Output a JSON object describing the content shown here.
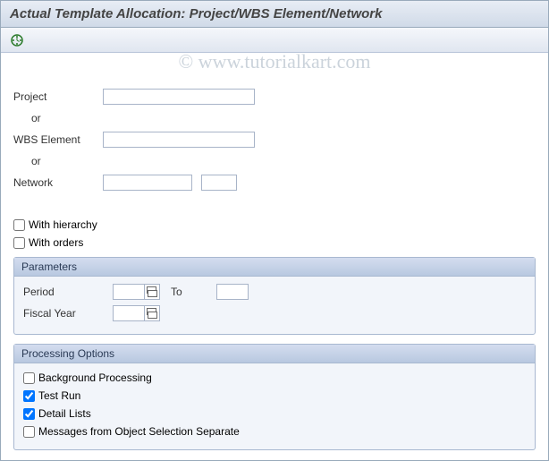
{
  "title": "Actual Template Allocation: Project/WBS Element/Network",
  "watermark": "© www.tutorialkart.com",
  "selection": {
    "project_label": "Project",
    "project_value": "",
    "or1": "or",
    "wbs_label": "WBS Element",
    "wbs_value": "",
    "or2": "or",
    "network_label": "Network",
    "network_value": "",
    "network_activity_value": ""
  },
  "options": {
    "with_hierarchy_label": "With hierarchy",
    "with_hierarchy_checked": false,
    "with_orders_label": "With orders",
    "with_orders_checked": false
  },
  "parameters": {
    "header": "Parameters",
    "period_label": "Period",
    "period_from": "",
    "to_label": "To",
    "period_to": "",
    "fiscal_year_label": "Fiscal Year",
    "fiscal_year_value": ""
  },
  "processing": {
    "header": "Processing Options",
    "background_label": "Background Processing",
    "background_checked": false,
    "testrun_label": "Test Run",
    "testrun_checked": true,
    "detail_label": "Detail Lists",
    "detail_checked": true,
    "messages_label": "Messages from Object Selection Separate",
    "messages_checked": false
  }
}
